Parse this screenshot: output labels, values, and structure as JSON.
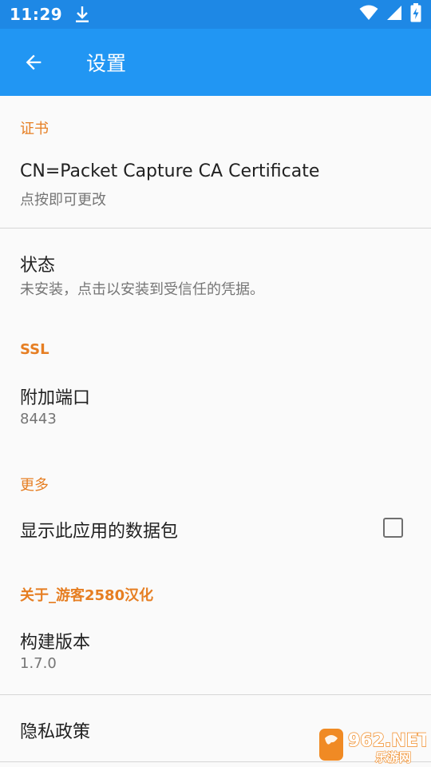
{
  "status_bar": {
    "time": "11:29",
    "icons": [
      "download-icon",
      "wifi-icon",
      "signal-icon",
      "battery-charging-icon"
    ]
  },
  "app_bar": {
    "title": "设置",
    "back_icon": "arrow-back-icon"
  },
  "sections": {
    "certificate": {
      "header": "证书",
      "cert_item": {
        "title": "CN=Packet Capture CA Certificate",
        "summary": "点按即可更改"
      },
      "status_item": {
        "title": "状态",
        "summary": "未安装，点击以安装到受信任的凭据。"
      }
    },
    "ssl": {
      "header": "SSL",
      "port_item": {
        "title": "附加端口",
        "summary": "8443"
      }
    },
    "more": {
      "header": "更多",
      "show_packets_item": {
        "title": "显示此应用的数据包",
        "checked": false
      }
    },
    "about": {
      "header": "关于_游客2580汉化",
      "build_item": {
        "title": "构建版本",
        "summary": "1.7.0"
      },
      "privacy_item": {
        "title": "隐私政策"
      }
    }
  },
  "watermark": {
    "text_top": "962.NET",
    "text_bottom": "乐游网"
  },
  "colors": {
    "status_bar": "#1e88e5",
    "app_bar": "#2196f3",
    "section_header": "#e67e22",
    "background": "#fafafa"
  }
}
